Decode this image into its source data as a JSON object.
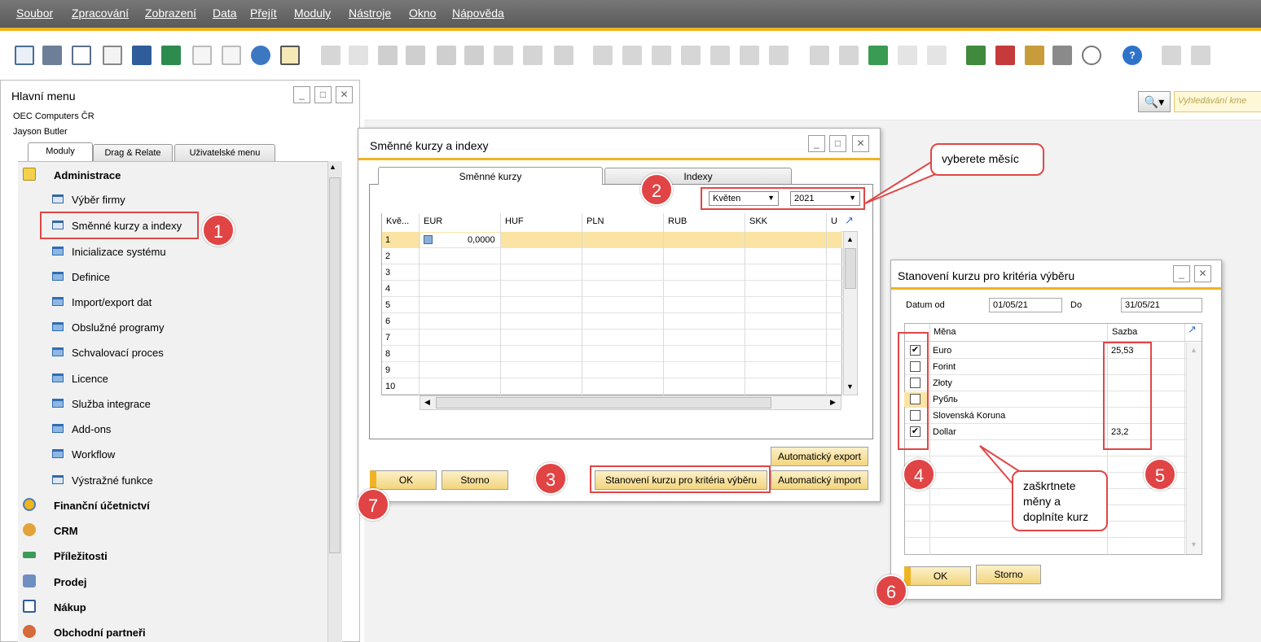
{
  "menubar": [
    "Soubor",
    "Zpracování",
    "Zobrazení",
    "Data",
    "Přejít",
    "Moduly",
    "Nástroje",
    "Okno",
    "Nápověda"
  ],
  "search": {
    "placeholder": "Vyhledávání kme"
  },
  "main_menu": {
    "title": "Hlavní menu",
    "company": "OEC Computers ČR",
    "user": "Jayson Butler",
    "tabs": [
      "Moduly",
      "Drag & Relate",
      "Uživatelské menu"
    ],
    "section": "Administrace",
    "items": [
      "Výběr firmy",
      "Směnné kurzy a indexy",
      "Inicializace systému",
      "Definice",
      "Import/export dat",
      "Obslužné programy",
      "Schvalovací proces",
      "Licence",
      "Služba integrace",
      "Add-ons",
      "Workflow",
      "Výstražné funkce"
    ],
    "categories": [
      "Finanční účetnictví",
      "CRM",
      "Příležitosti",
      "Prodej",
      "Nákup",
      "Obchodní partneři"
    ]
  },
  "exchange": {
    "title": "Směnné kurzy a indexy",
    "tabs": [
      "Směnné kurzy",
      "Indexy"
    ],
    "month": "Květen",
    "year": "2021",
    "columns": [
      "Kvě...",
      "EUR",
      "HUF",
      "PLN",
      "RUB",
      "SKK",
      "U"
    ],
    "rows": [
      "1",
      "2",
      "3",
      "4",
      "5",
      "6",
      "7",
      "8",
      "9",
      "10"
    ],
    "first_value": "0,0000",
    "buttons": {
      "ok": "OK",
      "cancel": "Storno",
      "criteria": "Stanovení kurzu pro kritéria výběru",
      "export": "Automatický export",
      "import": "Automatický import"
    }
  },
  "criteria": {
    "title": "Stanovení kurzu pro kritéria výběru",
    "date_from_label": "Datum od",
    "date_from": "01/05/21",
    "date_to_label": "Do",
    "date_to": "31/05/21",
    "col_currency": "Měna",
    "col_rate": "Sazba",
    "rows": [
      {
        "name": "Euro",
        "checked": true,
        "rate": "25,53"
      },
      {
        "name": "Forint",
        "checked": false,
        "rate": ""
      },
      {
        "name": "Złoty",
        "checked": false,
        "rate": ""
      },
      {
        "name": "Рубль",
        "checked": false,
        "rate": ""
      },
      {
        "name": "Slovenská Koruna",
        "checked": false,
        "rate": ""
      },
      {
        "name": "Dollar",
        "checked": true,
        "rate": "23,2"
      }
    ],
    "buttons": {
      "ok": "OK",
      "cancel": "Storno"
    }
  },
  "annotations": {
    "bubble_month": "vyberete měsíc",
    "bubble_currency": [
      "zaškrtnete",
      "měny a",
      "doplníte kurz"
    ],
    "steps": [
      "1",
      "2",
      "3",
      "4",
      "5",
      "6",
      "7"
    ]
  },
  "colors": {
    "accent": "#f0b323",
    "annotation": "#e04444"
  }
}
